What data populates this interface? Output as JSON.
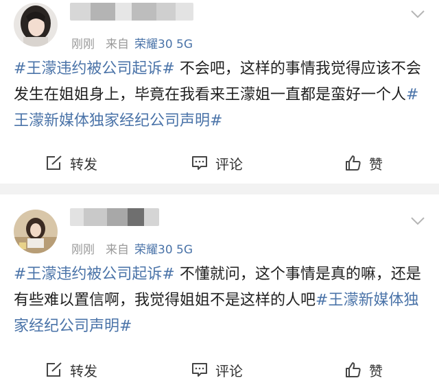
{
  "posts": [
    {
      "username": "",
      "time": "刚刚",
      "source_prefix": "来自",
      "device": "荣耀30 5G",
      "content": {
        "tag1": "#王濛违约被公司起诉#",
        "text": " 不会吧，这样的事情我觉得应该不会发生在姐姐身上，毕竟在我看来王濛姐一直都是蛮好一个人",
        "tag2": "#王濛新媒体独家经纪公司声明#"
      },
      "actions": {
        "repost": "转发",
        "comment": "评论",
        "like": "赞"
      }
    },
    {
      "username": "",
      "time": "刚刚",
      "source_prefix": "来自",
      "device": "荣耀30 5G",
      "content": {
        "tag1": "#王濛违约被公司起诉#",
        "text": " 不懂就问，这个事情是真的嘛，还是有些难以置信啊，我觉得姐姐不是这样的人吧",
        "tag2": "#王濛新媒体独家经纪公司声明#"
      },
      "actions": {
        "repost": "转发",
        "comment": "评论",
        "like": "赞"
      }
    }
  ],
  "colors": {
    "link": "#4a73a8",
    "meta": "#9a9a9a",
    "separator": "#f2f2f2"
  },
  "icons": [
    "chevron-down-icon",
    "repost-icon",
    "comment-icon",
    "like-icon"
  ]
}
